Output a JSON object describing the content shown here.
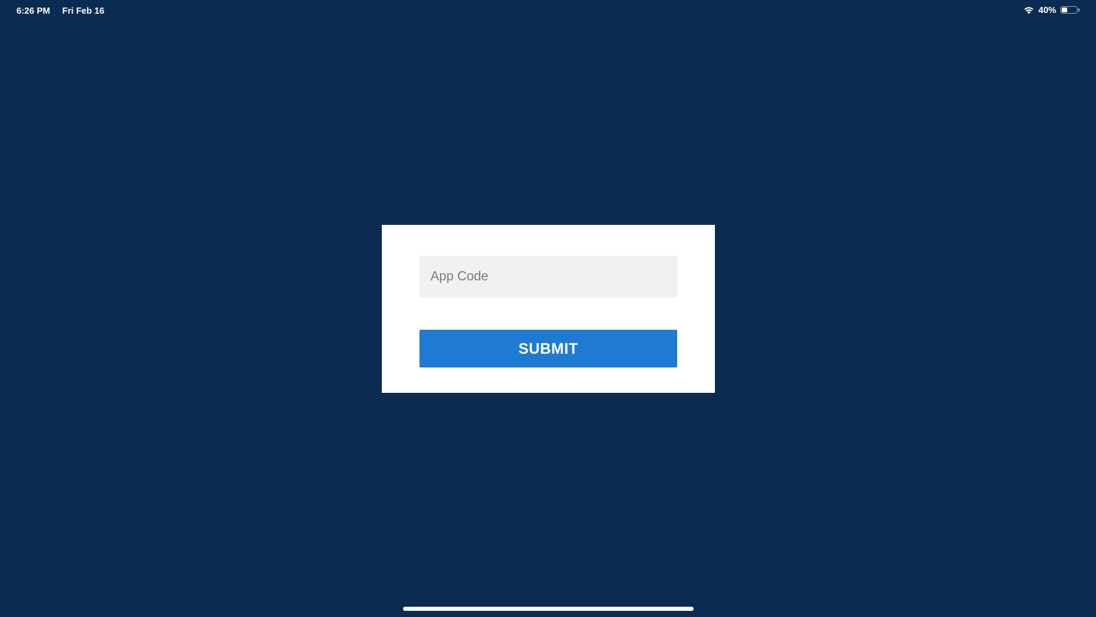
{
  "status_bar": {
    "time": "6:26 PM",
    "date": "Fri Feb 16",
    "battery_percent": "40%",
    "battery_level": 0.4,
    "wifi_icon": "wifi-icon",
    "battery_icon": "battery-icon"
  },
  "form": {
    "app_code_placeholder": "App Code",
    "app_code_value": "",
    "submit_label": "SUBMIT"
  },
  "colors": {
    "background": "#0b2c50",
    "card": "#ffffff",
    "input_background": "#f1f1f1",
    "accent": "#1f7ad3"
  }
}
